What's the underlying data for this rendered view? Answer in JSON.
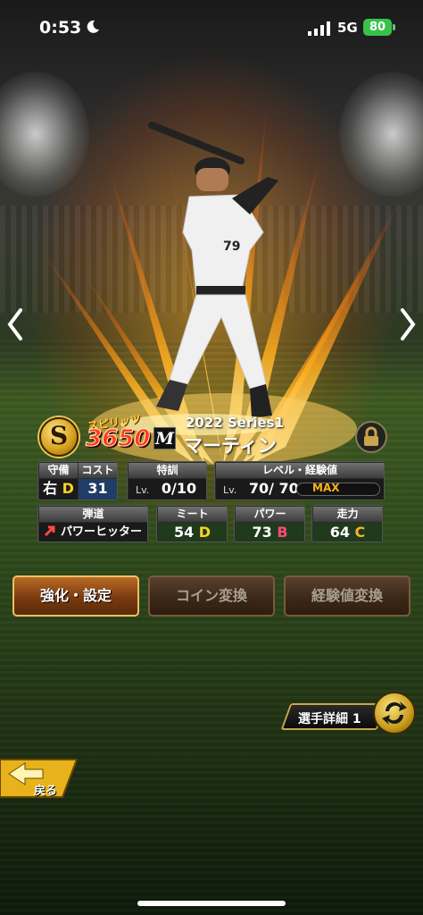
{
  "status_bar": {
    "time": "0:53",
    "network": "5G",
    "battery": "80"
  },
  "card": {
    "spirit_label": "スピリッツ",
    "spirit_value": "3650",
    "spirit_coin_letter": "S",
    "team_logo": "M",
    "series": "2022 Series1",
    "player_name": "マーティン",
    "uniform_number": "79"
  },
  "stats": {
    "position": {
      "label": "守備",
      "value": "右",
      "grade": "D"
    },
    "cost": {
      "label": "コスト",
      "value": "31"
    },
    "training": {
      "label": "特訓",
      "lv_prefix": "Lv.",
      "value": "0/10"
    },
    "level": {
      "label": "レベル・経験値",
      "lv_prefix": "Lv.",
      "value": "70/ 70",
      "max_label": "MAX"
    },
    "trajectory": {
      "label": "弾道",
      "value": "パワーヒッター"
    },
    "contact": {
      "label": "ミート",
      "value": "54",
      "grade": "D"
    },
    "power": {
      "label": "パワー",
      "value": "73",
      "grade": "B"
    },
    "speed": {
      "label": "走力",
      "value": "64",
      "grade": "C"
    }
  },
  "actions": {
    "enhance": "強化・設定",
    "coin_convert": "コイン変換",
    "exp_convert": "経験値変換"
  },
  "player_detail": "選手詳細 1",
  "back": "戻る",
  "colors": {
    "flame": "#ff8a1a",
    "accent_gold": "#d9a420",
    "grade_d": "#ffd12a",
    "grade_b": "#ff4a7a",
    "grade_c": "#ffb02a"
  },
  "icons": [
    "moon-icon",
    "signal-icon",
    "battery-icon",
    "chevron-left-icon",
    "chevron-right-icon",
    "lock-icon",
    "up-arrow-icon",
    "swap-icon",
    "back-arrow-icon"
  ]
}
